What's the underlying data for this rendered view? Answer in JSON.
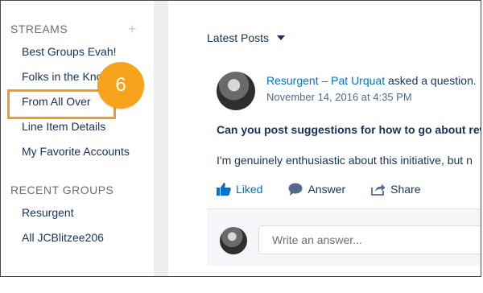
{
  "sidebar": {
    "streams_heading": "STREAMS",
    "add_symbol": "+",
    "streams": [
      {
        "label": "Best Groups Evah!"
      },
      {
        "label": "Folks in the Kno"
      },
      {
        "label": "From All Over"
      },
      {
        "label": "Line Item Details"
      },
      {
        "label": "My Favorite Accounts"
      }
    ],
    "recent_groups_heading": "RECENT GROUPS",
    "recent_groups": [
      {
        "label": "Resurgent"
      },
      {
        "label": "All JCBlitzee206"
      }
    ]
  },
  "callout": {
    "number": "6",
    "color": "#f7a21b"
  },
  "feed": {
    "sort_label": "Latest Posts",
    "post": {
      "group": "Resurgent",
      "separator": " – ",
      "author": "Pat Urquat",
      "action": " asked a question.",
      "timestamp": "November 14, 2016 at 4:35 PM",
      "question": "Can you post suggestions for how to go about rew",
      "body": "I'm genuinely enthusiastic about this initiative, but n",
      "actions": {
        "liked": "Liked",
        "answer": "Answer",
        "share": "Share"
      }
    },
    "reply_placeholder": "Write an answer..."
  },
  "colors": {
    "accent": "#0070d2",
    "text": "#16325c",
    "highlight": "#f19b2c"
  }
}
